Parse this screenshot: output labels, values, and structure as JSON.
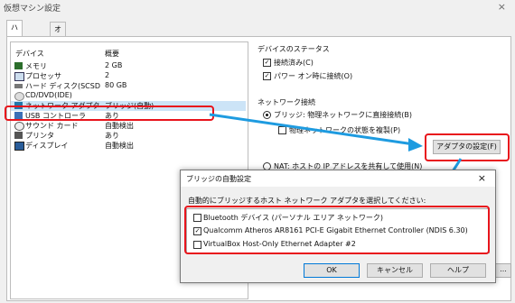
{
  "window": {
    "title": "仮想マシン設定",
    "close": "×"
  },
  "tabs": [
    {
      "label": "ハードウェア"
    },
    {
      "label": "オプション"
    }
  ],
  "device_list": {
    "col_device": "デバイス",
    "col_summary": "概要",
    "rows": [
      {
        "label": "メモリ",
        "value": "2 GB",
        "icon": "memory-icon"
      },
      {
        "label": "プロセッサ",
        "value": "2",
        "icon": "processor-icon"
      },
      {
        "label": "ハード ディスク(SCSD",
        "value": "80 GB",
        "icon": "hard-disk-icon"
      },
      {
        "label": "CD/DVD(IDE)",
        "value": "",
        "icon": "cd-dvd-icon"
      },
      {
        "label": "ネットワーク アダプタ",
        "value": "ブリッジ(自動)",
        "icon": "network-adapter-icon"
      },
      {
        "label": "USB コントローラ",
        "value": "あり",
        "icon": "usb-icon"
      },
      {
        "label": "サウンド カード",
        "value": "自動検出",
        "icon": "sound-card-icon"
      },
      {
        "label": "プリンタ",
        "value": "あり",
        "icon": "printer-icon"
      },
      {
        "label": "ディスプレイ",
        "value": "自動検出",
        "icon": "display-icon"
      }
    ]
  },
  "device_status": {
    "title": "デバイスのステータス",
    "connected": {
      "label": "接続済み(C)",
      "checked": true
    },
    "power_on": {
      "label": "パワー オン時に接続(O)",
      "checked": true
    }
  },
  "network": {
    "title": "ネットワーク接続",
    "bridge_label": "ブリッジ: 物理ネットワークに直接接続(B)",
    "replicate_label": "物理ネットワークの状態を複製(P)",
    "adapter_button": "アダプタの設定(F)",
    "nat_label": "NAT: ホストの IP アドレスを共有して使用(N)"
  },
  "dialog": {
    "title": "ブリッジの自動設定",
    "close": "×",
    "instruction": "自動的にブリッジするホスト ネットワーク アダプタを選択してください:",
    "adapters": [
      {
        "label": "Bluetooth デバイス (パーソナル エリア ネットワーク)",
        "checked": false
      },
      {
        "label": "Qualcomm Atheros AR8161 PCI-E Gigabit Ethernet Controller (NDIS 6.30)",
        "checked": true
      },
      {
        "label": "VirtualBox Host-Only Ethernet Adapter #2",
        "checked": false
      }
    ],
    "ok": "OK",
    "cancel": "キャンセル",
    "help": "ヘルプ"
  },
  "partial_button": "...",
  "colors": {
    "highlight": "#e8141c",
    "arrow": "#1e9be0"
  }
}
